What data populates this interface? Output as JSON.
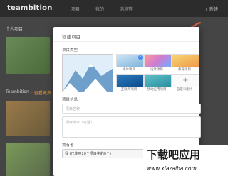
{
  "app": {
    "logo": "teambition",
    "nav": [
      "项目",
      "我的",
      "消息等"
    ],
    "top_right": "+ 新建"
  },
  "background": {
    "section_personal": "个人项目",
    "section_team": "Teambition",
    "section_team_link": "· 查看更多"
  },
  "modal": {
    "title": "创建项目",
    "type_section": "项目类型",
    "thumbs": [
      {
        "label": "媒体项目"
      },
      {
        "label": "设计项目"
      },
      {
        "label": "教育项目"
      },
      {
        "label": "互联网项目"
      },
      {
        "label": "移动应用项目"
      },
      {
        "label": "自定义图片"
      }
    ],
    "info_section": "项目信息",
    "name_placeholder": "项目名称",
    "desc_placeholder": "项目简介（可选）",
    "owner_section": "拥有者",
    "owner_value": "我 (已使用20个项目中的0个)"
  },
  "watermark": {
    "line1": "下载吧应用",
    "line2": "www.xiazaiba.com"
  },
  "colors": {
    "accent_arrow": "#e3673b",
    "check_blue": "#3a86ff"
  }
}
